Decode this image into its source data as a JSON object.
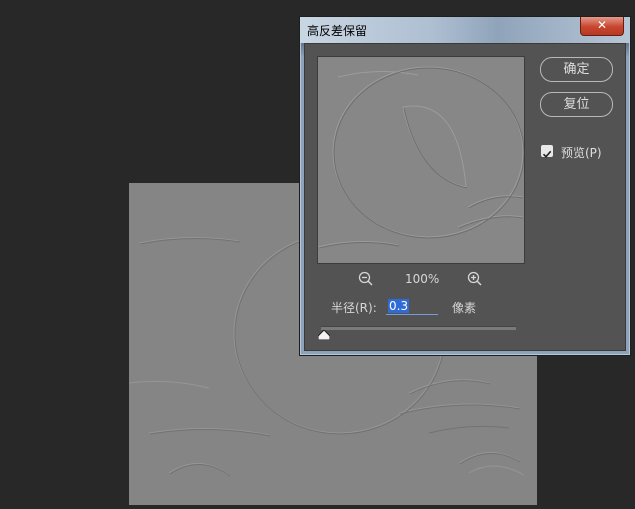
{
  "dialog": {
    "title": "高反差保留",
    "close_symbol": "✕",
    "ok_label": "确定",
    "reset_label": "复位",
    "preview_label": "预览(P)",
    "preview_checked": true,
    "zoom_level": "100%",
    "radius_label": "半径(R):",
    "radius_value": "0.3",
    "radius_unit": "像素",
    "radius_slider_fraction": 0.0
  },
  "icons": {
    "zoom_out": "zoom-out-icon",
    "zoom_in": "zoom-in-icon",
    "close": "close-icon",
    "checkbox": "checkmark-icon"
  },
  "colors": {
    "workspace_bg": "#282828",
    "dialog_body": "#535353",
    "close_button": "#c8452e",
    "selection": "#2f6bd6",
    "image_gray": "#858585"
  }
}
